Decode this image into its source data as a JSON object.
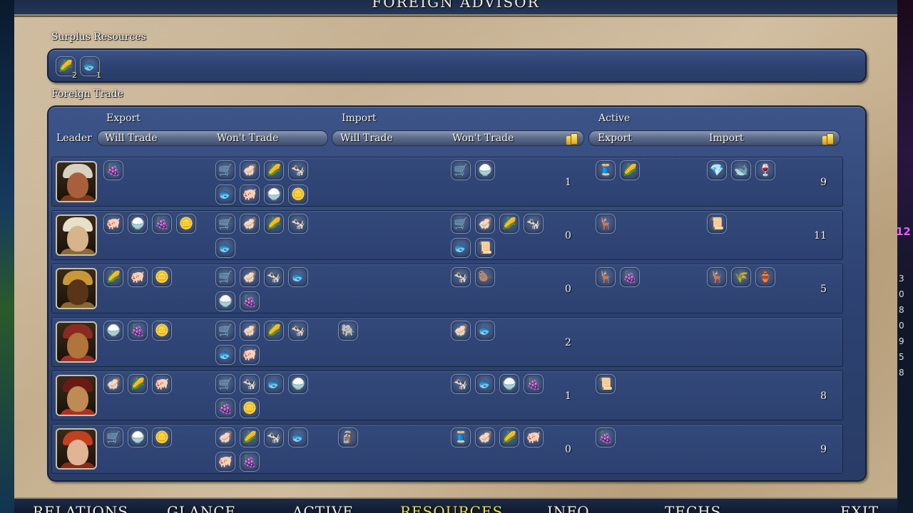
{
  "title": "FOREIGN ADVISOR",
  "surplus": {
    "label": "Surplus Resources",
    "items": [
      {
        "icon": "corn-icon",
        "glyph": "🌽",
        "count": "2"
      },
      {
        "icon": "fish-icon",
        "glyph": "🐟",
        "count": "1"
      }
    ]
  },
  "trade": {
    "label": "Foreign Trade",
    "groups": {
      "export": "Export",
      "import": "Import",
      "active": "Active"
    },
    "columns": {
      "leader": "Leader",
      "export_will": "Will Trade",
      "export_wont": "Won't Trade",
      "import_will": "Will Trade",
      "import_wont": "Won't Trade",
      "active_export": "Export",
      "active_import": "Import"
    },
    "rows": [
      {
        "leader": "leader-1",
        "portrait": {
          "skin": "#a8603c",
          "hat": "#d8d0c0",
          "body": "#7a3a1a"
        },
        "export_will": [
          [
            "dye-icon",
            "🍇"
          ]
        ],
        "export_wont": [
          [
            "wagon-icon",
            "🛒"
          ],
          [
            "clam-icon",
            "🦪"
          ],
          [
            "corn-icon",
            "🌽"
          ],
          [
            "cow-icon",
            "🐄"
          ],
          [
            "fish-icon",
            "🐟"
          ],
          [
            "pig-icon",
            "🐖"
          ],
          [
            "rice-icon",
            "🍚"
          ],
          [
            "gold-icon",
            "🪙"
          ]
        ],
        "import_will": [],
        "import_wont": [
          [
            "wagon-icon",
            "🛒"
          ],
          [
            "rice-icon",
            "🍚"
          ]
        ],
        "gold_left": "1",
        "active_export": [
          [
            "silk-icon",
            "🧵"
          ],
          [
            "corn-icon",
            "🌽"
          ]
        ],
        "active_import": [
          [
            "gems-icon",
            "💎"
          ],
          [
            "whale-icon",
            "🐋"
          ],
          [
            "wine-icon",
            "🍷"
          ]
        ],
        "gold_right": "9"
      },
      {
        "leader": "leader-2",
        "portrait": {
          "skin": "#d8b48c",
          "hat": "#e8e0c8",
          "body": "#8c6a3a"
        },
        "export_will": [
          [
            "pig-icon",
            "🐖"
          ],
          [
            "rice-icon",
            "🍚"
          ],
          [
            "dye-icon",
            "🍇"
          ],
          [
            "gold-icon",
            "🪙"
          ]
        ],
        "export_wont": [
          [
            "wagon-icon",
            "🛒"
          ],
          [
            "clam-icon",
            "🦪"
          ],
          [
            "corn-icon",
            "🌽"
          ],
          [
            "cow-icon",
            "🐄"
          ],
          [
            "fish-icon",
            "🐟"
          ]
        ],
        "import_will": [],
        "import_wont": [
          [
            "wagon-icon",
            "🛒"
          ],
          [
            "clam-icon",
            "🦪"
          ],
          [
            "corn-icon",
            "🌽"
          ],
          [
            "cow-icon",
            "🐄"
          ],
          [
            "fish-icon",
            "🐟"
          ],
          [
            "paper-icon",
            "📜"
          ]
        ],
        "gold_left": "0",
        "active_export": [
          [
            "deer-icon",
            "🦌"
          ]
        ],
        "active_import": [
          [
            "paper-icon",
            "📜"
          ]
        ],
        "gold_right": "11"
      },
      {
        "leader": "leader-3",
        "portrait": {
          "skin": "#5a3418",
          "hat": "#c89838",
          "body": "#8a6a2a"
        },
        "export_will": [
          [
            "corn-icon",
            "🌽"
          ],
          [
            "pig-icon",
            "🐖"
          ],
          [
            "gold-icon",
            "🪙"
          ]
        ],
        "export_wont": [
          [
            "wagon-icon",
            "🛒"
          ],
          [
            "clam-icon",
            "🦪"
          ],
          [
            "cow-icon",
            "🐄"
          ],
          [
            "fish-icon",
            "🐟"
          ],
          [
            "rice-icon",
            "🍚"
          ],
          [
            "dye-icon",
            "🍇"
          ]
        ],
        "import_will": [],
        "import_wont": [
          [
            "cow-icon",
            "🐄"
          ],
          [
            "beaver-icon",
            "🦫"
          ]
        ],
        "gold_left": "0",
        "active_export": [
          [
            "deer-icon",
            "🦌"
          ],
          [
            "dye-icon",
            "🍇"
          ]
        ],
        "active_import": [
          [
            "deer-icon",
            "🦌"
          ],
          [
            "wheat-icon",
            "🌾"
          ],
          [
            "incense-icon",
            "🏺"
          ]
        ],
        "gold_right": "5"
      },
      {
        "leader": "leader-4",
        "portrait": {
          "skin": "#b0743c",
          "hat": "#8a2a20",
          "body": "#a0302a"
        },
        "export_will": [
          [
            "rice-icon",
            "🍚"
          ],
          [
            "dye-icon",
            "🍇"
          ],
          [
            "gold-icon",
            "🪙"
          ]
        ],
        "export_wont": [
          [
            "wagon-icon",
            "🛒"
          ],
          [
            "clam-icon",
            "🦪"
          ],
          [
            "corn-icon",
            "🌽"
          ],
          [
            "cow-icon",
            "🐄"
          ],
          [
            "fish-icon",
            "🐟"
          ],
          [
            "pig-icon",
            "🐖"
          ]
        ],
        "import_will": [
          [
            "elephant-icon",
            "🐘"
          ]
        ],
        "import_wont": [
          [
            "clam-icon",
            "🦪"
          ],
          [
            "fish-icon",
            "🐟"
          ]
        ],
        "gold_left": "2",
        "active_export": [],
        "active_import": [],
        "gold_right": ""
      },
      {
        "leader": "leader-5",
        "portrait": {
          "skin": "#c08a54",
          "hat": "#6a1a14",
          "body": "#b03020"
        },
        "export_will": [
          [
            "clam-icon",
            "🦪"
          ],
          [
            "corn-icon",
            "🌽"
          ],
          [
            "pig-icon",
            "🐖"
          ]
        ],
        "export_wont": [
          [
            "wagon-icon",
            "🛒"
          ],
          [
            "cow-icon",
            "🐄"
          ],
          [
            "fish-icon",
            "🐟"
          ],
          [
            "rice-icon",
            "🍚"
          ],
          [
            "dye-icon",
            "🍇"
          ],
          [
            "gold-icon",
            "🪙"
          ]
        ],
        "import_will": [],
        "import_wont": [
          [
            "cow-icon",
            "🐄"
          ],
          [
            "fish-icon",
            "🐟"
          ],
          [
            "rice-icon",
            "🍚"
          ],
          [
            "dye-icon",
            "🍇"
          ]
        ],
        "gold_left": "1",
        "active_export": [
          [
            "paper-icon",
            "📜"
          ]
        ],
        "active_import": [],
        "gold_right": "8"
      },
      {
        "leader": "leader-6",
        "portrait": {
          "skin": "#e0b494",
          "hat": "#c04020",
          "body": "#8a2a1a"
        },
        "export_will": [
          [
            "wagon-icon",
            "🛒"
          ],
          [
            "rice-icon",
            "🍚"
          ],
          [
            "gold-icon",
            "🪙"
          ]
        ],
        "export_wont": [
          [
            "clam-icon",
            "🦪"
          ],
          [
            "corn-icon",
            "🌽"
          ],
          [
            "cow-icon",
            "🐄"
          ],
          [
            "fish-icon",
            "🐟"
          ],
          [
            "pig-icon",
            "🐖"
          ],
          [
            "dye-icon",
            "🍇"
          ]
        ],
        "import_will": [
          [
            "marble-icon",
            "🗿"
          ]
        ],
        "import_wont": [
          [
            "silk-icon",
            "🧵"
          ],
          [
            "clam-icon",
            "🦪"
          ],
          [
            "corn-icon",
            "🌽"
          ],
          [
            "pig-icon",
            "🐖"
          ]
        ],
        "gold_left": "0",
        "active_export": [
          [
            "dye-icon",
            "🍇"
          ]
        ],
        "active_import": [],
        "gold_right": "9"
      }
    ]
  },
  "nav": {
    "items": [
      "RELATIONS",
      "GLANCE",
      "ACTIVE",
      "RESOURCES",
      "INFO",
      "TECHS",
      "EXIT"
    ],
    "active": "RESOURCES"
  },
  "map_right": {
    "badge": "12",
    "numbers": [
      "3",
      "0",
      "8",
      "0",
      "9",
      "5",
      "8"
    ]
  }
}
